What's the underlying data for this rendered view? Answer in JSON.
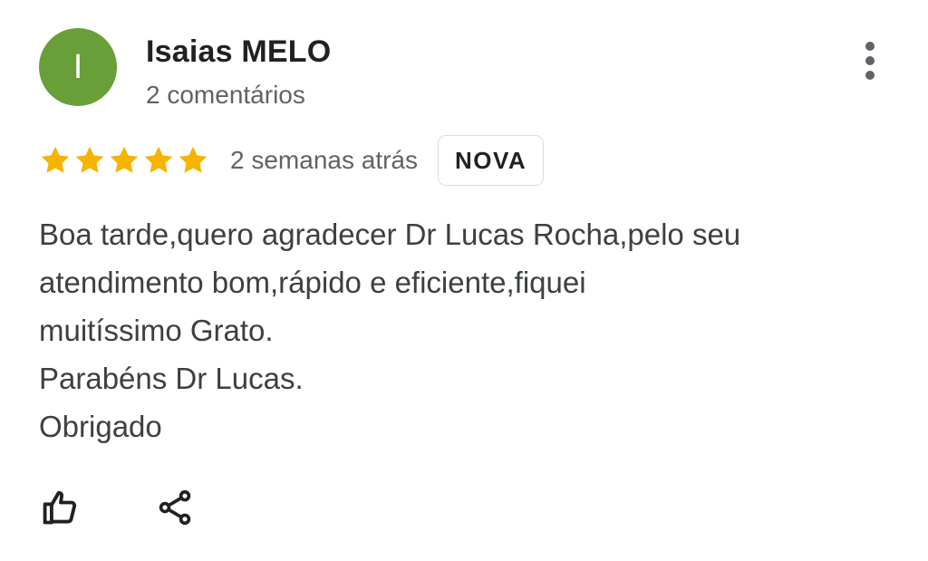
{
  "review": {
    "author": {
      "initial": "I",
      "name": "Isaias MELO",
      "meta": "2 comentários",
      "avatar_color": "#689f38"
    },
    "more_menu_icon": "more-vertical-icon",
    "rating": {
      "stars": 5,
      "max_stars": 5,
      "star_color": "#f6b400"
    },
    "date": "2 semanas atrás",
    "badge": "NOVA",
    "text_lines": [
      "Boa tarde,quero agradecer Dr Lucas Rocha,pelo seu",
      "atendimento bom,rápido e eficiente,fiquei",
      "muitíssimo Grato.",
      "Parabéns Dr Lucas.",
      "Obrigado"
    ],
    "actions": {
      "like_icon": "thumbs-up-icon",
      "share_icon": "share-icon"
    }
  }
}
